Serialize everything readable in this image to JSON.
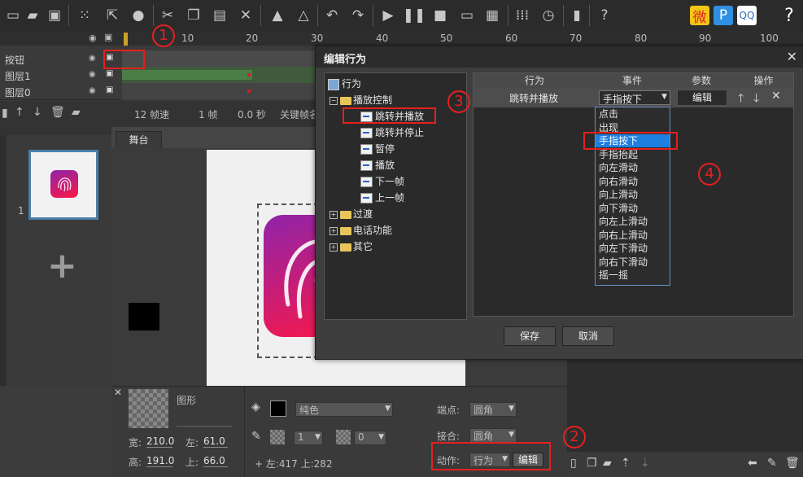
{
  "toolbar": {
    "icons": [
      "new-file-icon",
      "open-folder-icon",
      "save-icon",
      "grid-icon",
      "share-icon",
      "shape-icon",
      "cut-icon",
      "copy-icon",
      "paste-icon",
      "delete-icon",
      "lock-icon",
      "unlock-icon",
      "undo-icon",
      "redo-icon",
      "play-icon",
      "pause-icon",
      "stop-icon",
      "preview-icon",
      "qrcode-icon",
      "frames-icon",
      "clock-icon",
      "battery-icon",
      "help-icon",
      "weibo-icon",
      "pp-icon",
      "share-qq-icon",
      "question-icon"
    ]
  },
  "timeline": {
    "ruler": [
      "10",
      "20",
      "30",
      "40",
      "50",
      "60",
      "70",
      "80",
      "90",
      "100"
    ],
    "layers": [
      "按钮",
      "图层1",
      "图层0"
    ]
  },
  "frame_info": {
    "fps": "12 帧速",
    "frame": "1 帧",
    "time": "0.0 秒",
    "keyframe": "关键帧名"
  },
  "stage": {
    "tab": "舞台"
  },
  "left_panel": {
    "page_number": "1",
    "add_symbol": "+"
  },
  "properties": {
    "shape_label": "图形",
    "width_label": "宽:",
    "width_value": "210.0",
    "left_label": "左:",
    "left_value": "61.0",
    "height_label": "高:",
    "height_value": "191.0",
    "top_label": "上:",
    "top_value": "66.0",
    "fill_type": "纯色",
    "stroke_width": "1",
    "opacity": "0",
    "coords": "+ 左:417  上:282",
    "endpoint_label": "端点:",
    "endpoint_value": "圆角",
    "join_label": "接合:",
    "join_value": "圆角",
    "action_label": "动作:",
    "action_value": "行为",
    "edit_button": "编辑"
  },
  "dialog": {
    "title": "编辑行为",
    "tree": {
      "root": "行为",
      "group_playback": "播放控制",
      "leaf_goto_play": "跳转并播放",
      "leaf_goto_stop": "跳转并停止",
      "leaf_pause": "暂停",
      "leaf_play": "播放",
      "leaf_next": "下一帧",
      "leaf_prev": "上一帧",
      "group_transition": "过渡",
      "group_phone": "电话功能",
      "group_other": "其它"
    },
    "table": {
      "col_behavior": "行为",
      "col_event": "事件",
      "col_params": "参数",
      "col_ops": "操作",
      "row_behavior": "跳转并播放",
      "row_event": "手指按下",
      "row_edit": "编辑"
    },
    "event_options": [
      "点击",
      "出现",
      "手指按下",
      "手指抬起",
      "向左滑动",
      "向右滑动",
      "向上滑动",
      "向下滑动",
      "向左上滑动",
      "向右上滑动",
      "向左下滑动",
      "向右下滑动",
      "摇一摇"
    ],
    "save_button": "保存",
    "cancel_button": "取消"
  },
  "annotations": [
    "1",
    "2",
    "3",
    "4"
  ],
  "colors": {
    "highlight": "#1e7fe0",
    "annotation": "#e52020",
    "app_icon_gradient_top": "#8e24aa",
    "app_icon_gradient_bottom": "#ff1744"
  }
}
